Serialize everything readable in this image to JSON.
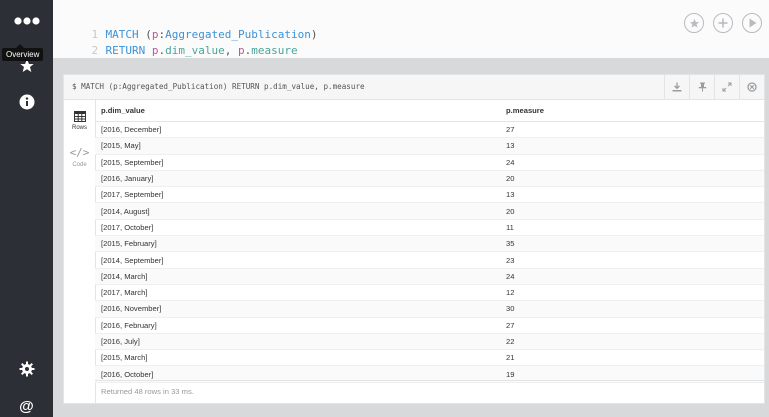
{
  "sidebar": {
    "tooltip": "Overview",
    "icons": [
      "database-icon",
      "star-icon",
      "info-icon",
      "gear-icon",
      "at-icon"
    ]
  },
  "editor": {
    "line1_num": "1",
    "line2_num": "2",
    "line1": {
      "kw": "MATCH",
      "open": " (",
      "var": "p",
      "colon": ":",
      "label": "Aggregated_Publication",
      "close": ")"
    },
    "line2": {
      "kw": "RETURN",
      "var1": " p",
      "dot1": ".",
      "prop1": "dim_value",
      "comma": ", ",
      "var2": "p",
      "dot2": ".",
      "prop2": "measure"
    }
  },
  "frame": {
    "query": "$ MATCH (p:Aggregated_Publication) RETURN p.dim_value, p.measure",
    "tabs": [
      {
        "label": "Rows"
      },
      {
        "label": "Code"
      }
    ],
    "columns": [
      "p.dim_value",
      "p.measure"
    ],
    "rows": [
      [
        "[2016, December]",
        "27"
      ],
      [
        "[2015, May]",
        "13"
      ],
      [
        "[2015, September]",
        "24"
      ],
      [
        "[2016, January]",
        "20"
      ],
      [
        "[2017, September]",
        "13"
      ],
      [
        "[2014, August]",
        "20"
      ],
      [
        "[2017, October]",
        "11"
      ],
      [
        "[2015, February]",
        "35"
      ],
      [
        "[2014, September]",
        "23"
      ],
      [
        "[2014, March]",
        "24"
      ],
      [
        "[2017, March]",
        "12"
      ],
      [
        "[2016, November]",
        "30"
      ],
      [
        "[2016, February]",
        "27"
      ],
      [
        "[2016, July]",
        "22"
      ],
      [
        "[2015, March]",
        "21"
      ],
      [
        "[2016, October]",
        "19"
      ]
    ],
    "status": "Returned 48 rows in 33 ms."
  },
  "colors": {
    "sidebar_bg": "#2c2f35",
    "keyword": "#3d92d6",
    "variable": "#b85c8e",
    "property": "#4aa59a"
  }
}
